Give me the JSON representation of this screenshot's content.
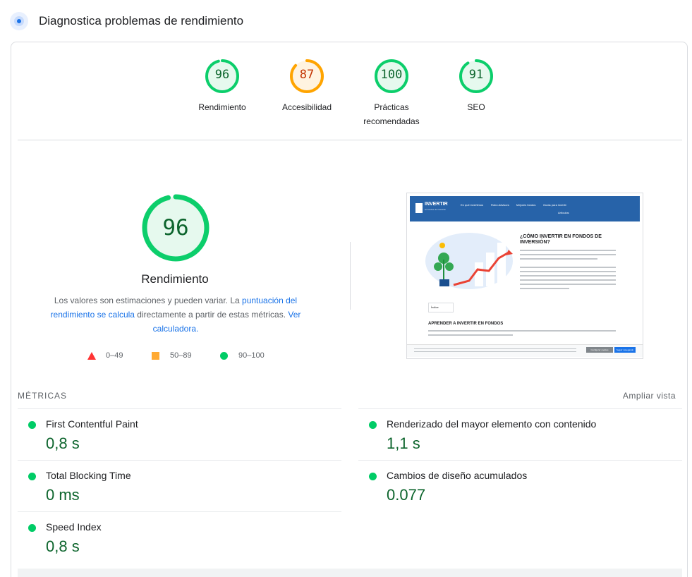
{
  "header": {
    "title": "Diagnostica problemas de rendimiento",
    "icon": "lighthouse-icon"
  },
  "gauges": [
    {
      "label": "Rendimiento",
      "score": 96,
      "color": "#0cce6b",
      "text_color": "#0d652d",
      "bg_color": "#e6f9ee"
    },
    {
      "label": "Accesibilidad",
      "score": 87,
      "color": "#ffa400",
      "text_color": "#c33300",
      "bg_color": "#fff3e0"
    },
    {
      "label": "Prácticas recomendadas",
      "score": 100,
      "color": "#0cce6b",
      "text_color": "#0d652d",
      "bg_color": "#e6f9ee"
    },
    {
      "label": "SEO",
      "score": 91,
      "color": "#0cce6b",
      "text_color": "#0d652d",
      "bg_color": "#e6f9ee"
    }
  ],
  "performance": {
    "score": 96,
    "title": "Rendimiento",
    "desc_prefix": "Los valores son estimaciones y pueden variar. La ",
    "desc_link1": "puntuación del rendimiento se calcula",
    "desc_middle": " directamente a partir de estas métricas. ",
    "desc_link2": "Ver calculadora."
  },
  "legend": [
    {
      "shape": "triangle",
      "range": "0–49",
      "color": "#ff3333"
    },
    {
      "shape": "square",
      "range": "50–89",
      "color": "#ffaa33"
    },
    {
      "shape": "circle",
      "range": "90–100",
      "color": "#00cc66"
    }
  ],
  "screenshot": {
    "logo": "INVERTIR",
    "logo_sub": "en fondos de inversión",
    "nav": [
      "En qué invertimos",
      "Robo Advisors",
      "Mejores fondos",
      "Guías para invertir",
      "Artículos"
    ],
    "heading": "¿CÓMO INVERTIR EN FONDOS DE INVERSIÓN?",
    "index_label": "Índice",
    "section_heading": "APRENDER A INVERTIR EN FONDOS",
    "cookie_btn1": "Configurar cookies",
    "cookie_btn2": "Seguir navegando"
  },
  "metrics": {
    "label": "MÉTRICAS",
    "expand": "Ampliar vista",
    "items": [
      {
        "name": "First Contentful Paint",
        "value": "0,8 s"
      },
      {
        "name": "Renderizado del mayor elemento con contenido",
        "value": "1,1 s"
      },
      {
        "name": "Total Blocking Time",
        "value": "0 ms"
      },
      {
        "name": "Cambios de diseño acumulados",
        "value": "0.077"
      },
      {
        "name": "Speed Index",
        "value": "0,8 s"
      }
    ]
  }
}
